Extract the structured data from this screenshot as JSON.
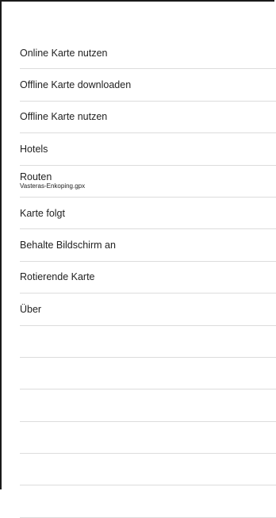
{
  "menu": {
    "items": [
      {
        "label": "Online Karte nutzen"
      },
      {
        "label": "Offline Karte downloaden"
      },
      {
        "label": "Offline Karte nutzen"
      },
      {
        "label": "Hotels"
      },
      {
        "label": "Routen",
        "sublabel": "Vasteras-Enkoping.gpx"
      },
      {
        "label": "Karte folgt"
      },
      {
        "label": "Behalte Bildschirm an"
      },
      {
        "label": "Rotierende Karte"
      },
      {
        "label": "Über"
      }
    ]
  }
}
